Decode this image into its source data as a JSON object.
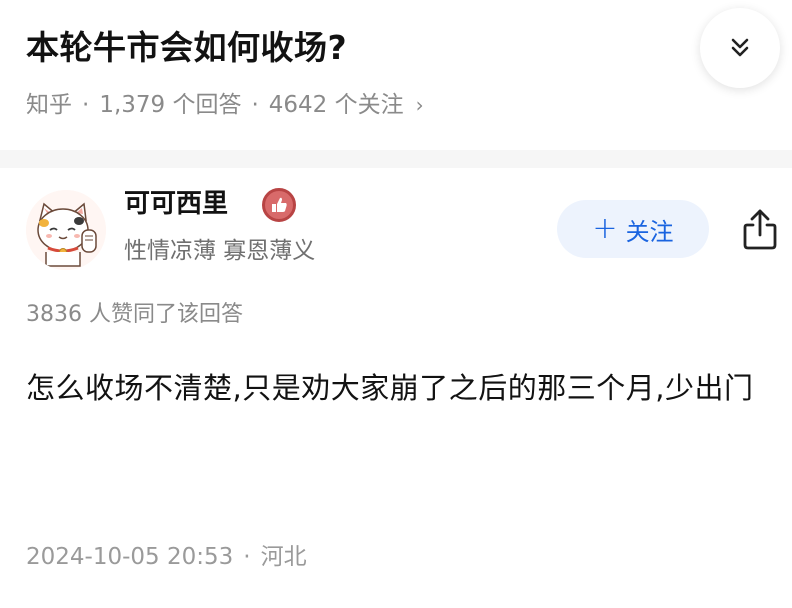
{
  "question": {
    "title": "本轮牛市会如何收场?",
    "source": "知乎",
    "answer_count": "1,379 个回答",
    "follower_count": "4642 个关注",
    "separator": "·",
    "more_glyph": "›"
  },
  "author": {
    "name": "可可西里",
    "bio": "性情凉薄 寡恩薄义",
    "badge_icon": "thumbs-up-badge-icon",
    "avatar_icon": "lucky-cat-icon"
  },
  "follow_button": {
    "plus": "+",
    "label": "关注"
  },
  "answer": {
    "vote_summary": "3836 人赞同了该回答",
    "content": "怎么收场不清楚,只是劝大家崩了之后的那三个月,少出门",
    "timestamp": "2024-10-05 20:53",
    "location": "河北",
    "separator": "·"
  },
  "colors": {
    "accent": "#1a64e0",
    "follow_bg": "#edf3fd",
    "muted_text": "#8a8a8a",
    "badge": "#d86a6a"
  }
}
